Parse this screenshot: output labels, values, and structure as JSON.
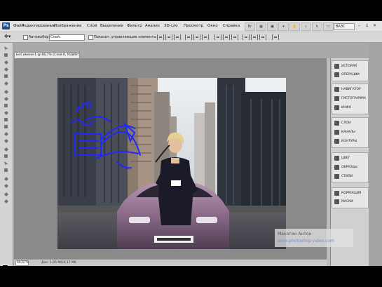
{
  "app": {
    "logo": "Ps"
  },
  "menu": {
    "items": [
      "Файл",
      "Редактирование",
      "Изображение",
      "Слой",
      "Выделение",
      "Фильтр",
      "Анализ",
      "3D-сло",
      "Просмотр",
      "Окно",
      "Справка"
    ],
    "workspace": "ВАЗС",
    "toolbar_icons": [
      "bridge-icon",
      "mini-bridge-icon",
      "arrange-icon",
      "zoom-level-icon",
      "hand-icon",
      "zoom-icon",
      "rotate-icon",
      "grid-icon",
      "screen-mode-icon"
    ]
  },
  "options_bar": {
    "autoselect_label": "Автовыбор:",
    "autoselect_value": "Слой",
    "transform_label": "Показат. управляющие элементы"
  },
  "document": {
    "tab_title": "Без имени-1 @ 66,7% (Слой 0, RGB/8*)",
    "zoom": "66,67%",
    "info": "Док: 1,05 Мб/4,17 Мб"
  },
  "watermark": {
    "name": "Макотин Антон",
    "url": "www.photoshop-video.com"
  },
  "panels": {
    "group1": [
      {
        "icon": "history-icon",
        "label": "ИСТОРИЯ"
      },
      {
        "icon": "actions-icon",
        "label": "ОПЕРАЦИИ"
      }
    ],
    "group2": [
      {
        "icon": "navigator-icon",
        "label": "НАВИГАТОР"
      },
      {
        "icon": "histogram-icon",
        "label": "ГИСТОГРАММА"
      },
      {
        "icon": "info-icon",
        "label": "ИНФО"
      }
    ],
    "group3": [
      {
        "icon": "layers-icon",
        "label": "СЛОИ"
      },
      {
        "icon": "channels-icon",
        "label": "КАНАЛЫ"
      },
      {
        "icon": "paths-icon",
        "label": "КОНТУРЫ"
      }
    ],
    "group4": [
      {
        "icon": "color-icon",
        "label": "ЦВЕТ"
      },
      {
        "icon": "swatches-icon",
        "label": "ОБРАЗЦЫ"
      },
      {
        "icon": "styles-icon",
        "label": "СТИЛИ"
      }
    ],
    "group5": [
      {
        "icon": "adjustments-icon",
        "label": "КОРРЕКЦИЯ"
      },
      {
        "icon": "masks-icon",
        "label": "МАСКИ"
      }
    ]
  },
  "colors": {
    "fg": "#000000",
    "bg": "#ffffff",
    "path_stroke": "#1e28ff"
  }
}
